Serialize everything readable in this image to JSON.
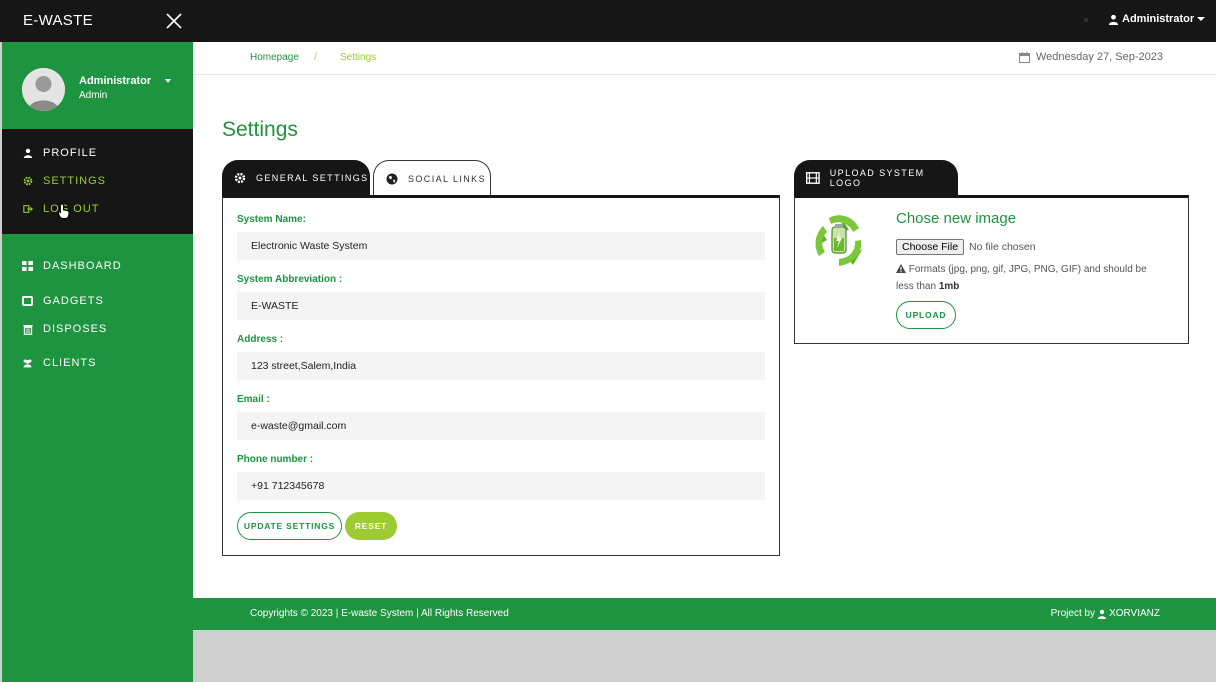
{
  "app": {
    "brand": "E-WASTE"
  },
  "topbar": {
    "user_label": "Administrator"
  },
  "sidebar": {
    "user": {
      "name": "Administrator",
      "role": "Admin"
    },
    "user_menu": [
      {
        "label": "PROFILE",
        "icon": "user-icon"
      },
      {
        "label": "SETTINGS",
        "icon": "gear-icon",
        "active": true
      },
      {
        "label": "LOG OUT",
        "icon": "sign-out-icon"
      }
    ],
    "nav": [
      {
        "label": "DASHBOARD",
        "icon": "dashboard-icon"
      },
      {
        "label": "GADGETS",
        "icon": "tablet-icon"
      },
      {
        "label": "DISPOSES",
        "icon": "trash-icon"
      },
      {
        "label": "CLIENTS",
        "icon": "users-icon"
      }
    ]
  },
  "breadcrumb": {
    "home": "Homepage",
    "separator": "/",
    "current": "Settings"
  },
  "date": "Wednesday 27, Sep-2023",
  "page_title": "Settings",
  "tabs": {
    "general": "GENERAL SETTINGS",
    "social": "SOCIAL LINKS",
    "upload": "UPLOAD SYSTEM LOGO"
  },
  "form": {
    "system_name": {
      "label": "System Name:",
      "value": "Electronic Waste System"
    },
    "abbreviation": {
      "label": "System Abbreviation :",
      "value": "E-WASTE"
    },
    "address": {
      "label": "Address :",
      "value": "123 street,Salem,India"
    },
    "email": {
      "label": "Email :",
      "value": "e-waste@gmail.com"
    },
    "phone": {
      "label": "Phone number :",
      "value": "+91 712345678"
    },
    "update_button": "UPDATE SETTINGS",
    "reset_button": "RESET"
  },
  "upload": {
    "title": "Chose new image",
    "choose_button": "Choose File",
    "no_file": "No file chosen",
    "hint_prefix": "Formats (jpg, png, gif, JPG, PNG, GIF) and should be less than ",
    "hint_size": "1mb",
    "upload_button": "UPLOAD"
  },
  "footer": {
    "copyright": "Copyrights © 2023 | E-waste System | All Rights Reserved",
    "project_prefix": "Project by",
    "project_name": "XORVIANZ"
  },
  "colors": {
    "primary": "#1e9440",
    "accent": "#9ccc31",
    "dark": "#161616"
  }
}
